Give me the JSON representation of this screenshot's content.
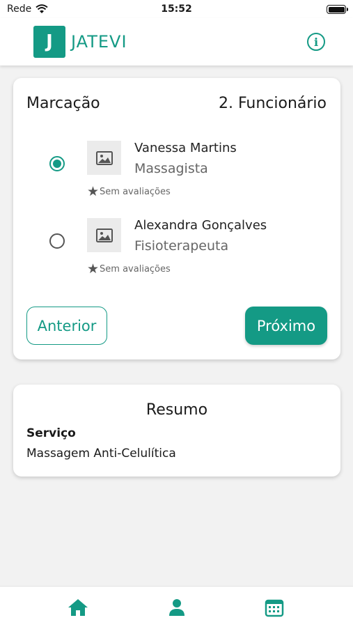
{
  "status_bar": {
    "carrier": "Rede",
    "time": "15:52"
  },
  "header": {
    "logo_letter": "J",
    "app_name": "JATEVI"
  },
  "booking": {
    "title": "Marcação",
    "step": "2. Funcionário",
    "employees": [
      {
        "name": "Vanessa Martins",
        "role": "Massagista",
        "rating": "Sem avaliações",
        "selected": true
      },
      {
        "name": "Alexandra Gonçalves",
        "role": "Fisioterapeuta",
        "rating": "Sem avaliações",
        "selected": false
      }
    ],
    "prev_label": "Anterior",
    "next_label": "Próximo"
  },
  "summary": {
    "title": "Resumo",
    "service_label": "Serviço",
    "service_value": "Massagem Anti-Celulítica"
  },
  "nav": {
    "items": [
      {
        "icon": "home-icon"
      },
      {
        "icon": "user-icon"
      },
      {
        "icon": "calendar-icon"
      }
    ]
  },
  "colors": {
    "accent": "#149a85",
    "background": "#f2f2f2"
  }
}
